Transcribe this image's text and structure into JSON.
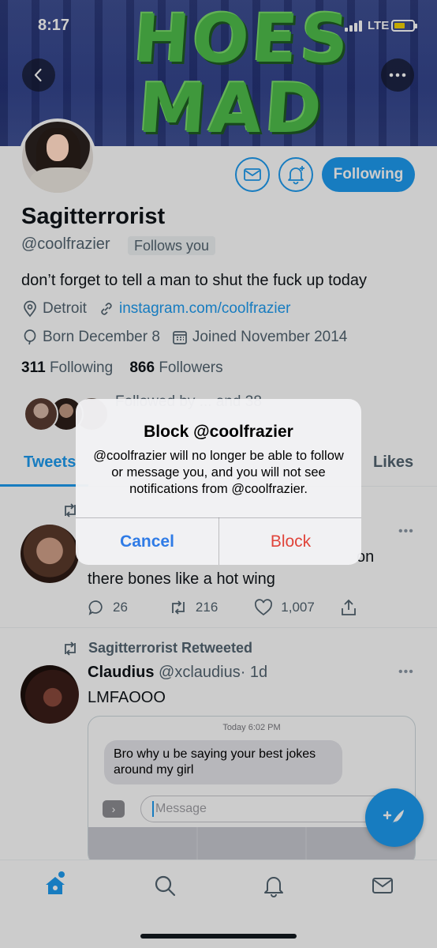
{
  "status_bar": {
    "time": "8:17",
    "network": "LTE"
  },
  "banner": {
    "line1": "HOES",
    "line2": "MAD"
  },
  "header_icons": {
    "back": "chevron-left-icon",
    "more": "ellipsis-icon"
  },
  "profile": {
    "name": "Sagitterrorist",
    "handle": "@coolfrazier",
    "follows_you": "Follows you",
    "follow_button": "Following",
    "bio": "don’t forget to tell a man to shut the fuck up today",
    "location": "Detroit",
    "website": "instagram.com/coolfrazier",
    "birthday": "Born December 8",
    "joined": "Joined November 2014",
    "following_count": "311",
    "following_label": "Following",
    "followers_count": "866",
    "followers_label": "Followers",
    "followed_by_known": "Followed by ... and 38"
  },
  "tabs": {
    "tweets": "Tweets",
    "likes": "Likes"
  },
  "tweets": [
    {
      "text": "there bones like a hot wing",
      "text_fragment": "on",
      "replies": "26",
      "retweets": "216",
      "likes": "1,007"
    },
    {
      "retweeted_by": "Sagitterrorist Retweeted",
      "author_name": "Claudius",
      "author_handle": "@xclaudius",
      "time": "· 1d",
      "text": "LMFAOOO",
      "embed": {
        "timestamp": "Today 6:02 PM",
        "bubble_text": "Bro why u be saying your best jokes around my girl",
        "input_placeholder": "Message"
      }
    }
  ],
  "dialog": {
    "title": "Block @coolfrazier",
    "message": "@coolfrazier will no longer be able to follow or message you, and you will not see notifications from @coolfrazier.",
    "cancel": "Cancel",
    "confirm": "Block"
  },
  "colors": {
    "accent": "#1d9bf0",
    "destructive": "#e0443a",
    "ios_blue": "#2f7be6"
  }
}
